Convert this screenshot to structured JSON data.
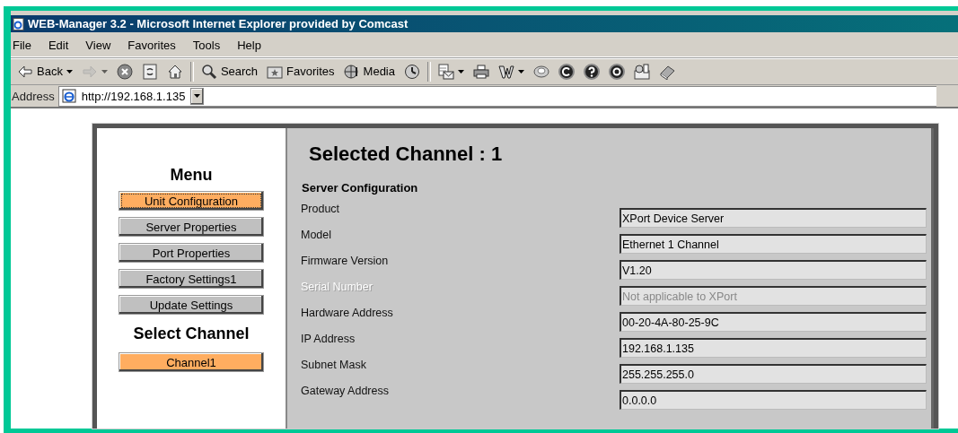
{
  "window": {
    "title": "WEB-Manager 3.2 - Microsoft Internet Explorer provided by Comcast"
  },
  "menu_bar": [
    "File",
    "Edit",
    "View",
    "Favorites",
    "Tools",
    "Help"
  ],
  "toolbar": [
    {
      "kind": "back",
      "label": "Back",
      "dropdown": true,
      "disabled": false
    },
    {
      "kind": "forward",
      "dropdown": true,
      "disabled": true
    },
    {
      "kind": "stop",
      "dropdown": false,
      "disabled": false
    },
    {
      "kind": "refresh",
      "dropdown": false,
      "disabled": false
    },
    {
      "kind": "home",
      "dropdown": false,
      "disabled": false
    },
    {
      "kind": "separator"
    },
    {
      "kind": "search",
      "label": "Search",
      "dropdown": false,
      "disabled": false
    },
    {
      "kind": "favorites",
      "label": "Favorites",
      "dropdown": false,
      "disabled": false
    },
    {
      "kind": "media",
      "label": "Media",
      "dropdown": false,
      "disabled": false
    },
    {
      "kind": "history",
      "dropdown": false,
      "disabled": false
    },
    {
      "kind": "separator"
    },
    {
      "kind": "mail",
      "dropdown": true,
      "disabled": false
    },
    {
      "kind": "print",
      "dropdown": false,
      "disabled": false
    },
    {
      "kind": "edit",
      "dropdown": true,
      "disabled": false
    },
    {
      "kind": "discuss",
      "dropdown": false,
      "disabled": false
    },
    {
      "kind": "copyright",
      "dropdown": false,
      "disabled": false
    },
    {
      "kind": "help",
      "dropdown": false,
      "disabled": false
    },
    {
      "kind": "target",
      "dropdown": false,
      "disabled": false
    },
    {
      "kind": "messenger",
      "dropdown": false,
      "disabled": false
    },
    {
      "kind": "book",
      "dropdown": false,
      "disabled": false
    }
  ],
  "address": {
    "label": "Address",
    "value": "http://192.168.1.135"
  },
  "page": {
    "menu_title": "Menu",
    "menu_items": [
      {
        "label": "Unit Configuration",
        "selected": true,
        "focused": true
      },
      {
        "label": "Server Properties",
        "selected": false,
        "focused": false
      },
      {
        "label": "Port Properties",
        "selected": false,
        "focused": false
      },
      {
        "label": "Factory Settings1",
        "selected": false,
        "focused": false
      },
      {
        "label": "Update Settings",
        "selected": false,
        "focused": false
      }
    ],
    "channel_title": "Select Channel",
    "channels": [
      {
        "label": "Channel1",
        "selected": true
      }
    ],
    "heading": "Selected Channel : 1",
    "section": "Server Configuration",
    "fields": [
      {
        "label": "Product",
        "value": "XPort Device Server",
        "disabled": false
      },
      {
        "label": "Model",
        "value": "Ethernet 1 Channel",
        "disabled": false
      },
      {
        "label": "Firmware Version",
        "value": "V1.20",
        "disabled": false
      },
      {
        "label": "Serial Number",
        "value": "Not applicable to XPort",
        "disabled": true
      },
      {
        "label": "Hardware Address",
        "value": "00-20-4A-80-25-9C",
        "disabled": false
      },
      {
        "label": "IP Address",
        "value": "192.168.1.135",
        "disabled": false
      },
      {
        "label": "Subnet Mask",
        "value": "255.255.255.0",
        "disabled": false
      },
      {
        "label": "Gateway Address",
        "value": "0.0.0.0",
        "disabled": false
      }
    ]
  }
}
